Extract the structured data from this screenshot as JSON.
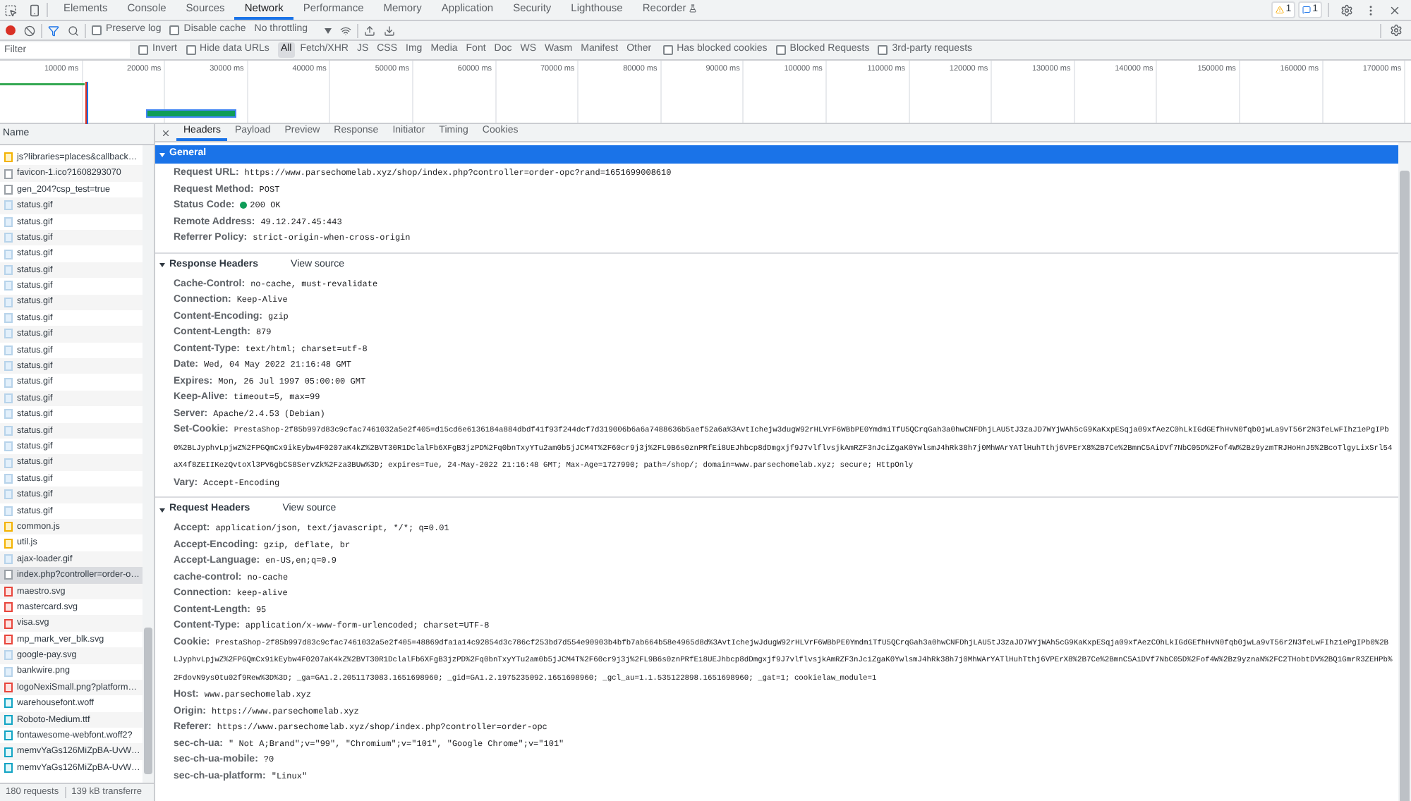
{
  "devtools_tabs": [
    {
      "label": "Elements",
      "selected": false
    },
    {
      "label": "Console",
      "selected": false
    },
    {
      "label": "Sources",
      "selected": false
    },
    {
      "label": "Network",
      "selected": true
    },
    {
      "label": "Performance",
      "selected": false
    },
    {
      "label": "Memory",
      "selected": false
    },
    {
      "label": "Application",
      "selected": false
    },
    {
      "label": "Security",
      "selected": false
    },
    {
      "label": "Lighthouse",
      "selected": false
    },
    {
      "label": "Recorder",
      "selected": false
    }
  ],
  "badges": {
    "warnings": "1",
    "messages": "1"
  },
  "toolbar": {
    "recording": true,
    "checkboxes": [
      {
        "label": "Preserve log",
        "checked": false
      },
      {
        "label": "Disable cache",
        "checked": false
      }
    ],
    "throttling": "No throttling"
  },
  "filter": {
    "placeholder": "Filter",
    "checkboxes_left": [
      {
        "label": "Invert",
        "checked": false
      },
      {
        "label": "Hide data URLs",
        "checked": false
      }
    ],
    "types": [
      {
        "label": "All",
        "selected": true
      },
      {
        "label": "Fetch/XHR",
        "selected": false
      },
      {
        "label": "JS",
        "selected": false
      },
      {
        "label": "CSS",
        "selected": false
      },
      {
        "label": "Img",
        "selected": false
      },
      {
        "label": "Media",
        "selected": false
      },
      {
        "label": "Font",
        "selected": false
      },
      {
        "label": "Doc",
        "selected": false
      },
      {
        "label": "WS",
        "selected": false
      },
      {
        "label": "Wasm",
        "selected": false
      },
      {
        "label": "Manifest",
        "selected": false
      },
      {
        "label": "Other",
        "selected": false
      }
    ],
    "checkboxes_right": [
      {
        "label": "Has blocked cookies",
        "checked": false
      },
      {
        "label": "Blocked Requests",
        "checked": false
      },
      {
        "label": "3rd-party requests",
        "checked": false
      }
    ]
  },
  "overview": {
    "ticks": [
      "10000 ms",
      "20000 ms",
      "30000 ms",
      "40000 ms",
      "50000 ms",
      "60000 ms",
      "70000 ms",
      "80000 ms",
      "90000 ms",
      "100000 ms",
      "110000 ms",
      "120000 ms",
      "130000 ms",
      "140000 ms",
      "150000 ms",
      "160000 ms",
      "170000 ms"
    ]
  },
  "requests": {
    "column": "Name",
    "items": [
      {
        "name": "js?libraries=places&callback…",
        "kind": "script",
        "selected": false
      },
      {
        "name": "favicon-1.ico?1608293070",
        "kind": "document",
        "selected": false
      },
      {
        "name": "gen_204?csp_test=true",
        "kind": "document",
        "selected": false
      },
      {
        "name": "status.gif",
        "kind": "image",
        "selected": false
      },
      {
        "name": "status.gif",
        "kind": "image",
        "selected": false
      },
      {
        "name": "status.gif",
        "kind": "image",
        "selected": false
      },
      {
        "name": "status.gif",
        "kind": "image",
        "selected": false
      },
      {
        "name": "status.gif",
        "kind": "image",
        "selected": false
      },
      {
        "name": "status.gif",
        "kind": "image",
        "selected": false
      },
      {
        "name": "status.gif",
        "kind": "image",
        "selected": false
      },
      {
        "name": "status.gif",
        "kind": "image",
        "selected": false
      },
      {
        "name": "status.gif",
        "kind": "image",
        "selected": false
      },
      {
        "name": "status.gif",
        "kind": "image",
        "selected": false
      },
      {
        "name": "status.gif",
        "kind": "image",
        "selected": false
      },
      {
        "name": "status.gif",
        "kind": "image",
        "selected": false
      },
      {
        "name": "status.gif",
        "kind": "image",
        "selected": false
      },
      {
        "name": "status.gif",
        "kind": "image",
        "selected": false
      },
      {
        "name": "status.gif",
        "kind": "image",
        "selected": false
      },
      {
        "name": "status.gif",
        "kind": "image",
        "selected": false
      },
      {
        "name": "status.gif",
        "kind": "image",
        "selected": false
      },
      {
        "name": "status.gif",
        "kind": "image",
        "selected": false
      },
      {
        "name": "status.gif",
        "kind": "image",
        "selected": false
      },
      {
        "name": "status.gif",
        "kind": "image",
        "selected": false
      },
      {
        "name": "common.js",
        "kind": "script",
        "selected": false
      },
      {
        "name": "util.js",
        "kind": "script",
        "selected": false
      },
      {
        "name": "ajax-loader.gif",
        "kind": "image",
        "selected": false
      },
      {
        "name": "index.php?controller=order-o…",
        "kind": "document",
        "selected": true
      },
      {
        "name": "maestro.svg",
        "kind": "card",
        "selected": false
      },
      {
        "name": "mastercard.svg",
        "kind": "card",
        "selected": false
      },
      {
        "name": "visa.svg",
        "kind": "card",
        "selected": false
      },
      {
        "name": "mp_mark_ver_blk.svg",
        "kind": "card",
        "selected": false
      },
      {
        "name": "google-pay.svg",
        "kind": "image",
        "selected": false
      },
      {
        "name": "bankwire.png",
        "kind": "image",
        "selected": false
      },
      {
        "name": "logoNexiSmall.png?platform…",
        "kind": "card",
        "selected": false
      },
      {
        "name": "warehousefont.woff",
        "kind": "font",
        "selected": false
      },
      {
        "name": "Roboto-Medium.ttf",
        "kind": "font",
        "selected": false
      },
      {
        "name": "fontawesome-webfont.woff2?",
        "kind": "font",
        "selected": false
      },
      {
        "name": "memvYaGs126MiZpBA-UvW…",
        "kind": "font",
        "selected": false
      },
      {
        "name": "memvYaGs126MiZpBA-UvW…",
        "kind": "font",
        "selected": false
      }
    ],
    "summary": [
      "180 requests",
      "139 kB transferre"
    ]
  },
  "detail": {
    "tabs": [
      {
        "label": "Headers",
        "selected": true
      },
      {
        "label": "Payload",
        "selected": false
      },
      {
        "label": "Preview",
        "selected": false
      },
      {
        "label": "Response",
        "selected": false
      },
      {
        "label": "Initiator",
        "selected": false
      },
      {
        "label": "Timing",
        "selected": false
      },
      {
        "label": "Cookies",
        "selected": false
      }
    ],
    "sections": [
      {
        "title": "General",
        "focused": true,
        "expanded": true,
        "rows": [
          {
            "name": "Request URL:",
            "value": "https://www.parsechomelab.xyz/shop/index.php?controller=order-opc?rand=1651699008610",
            "kind": "text"
          },
          {
            "name": "Request Method:",
            "value": "POST",
            "kind": "text"
          },
          {
            "name": "Status Code:",
            "value": "200 OK",
            "kind": "status"
          },
          {
            "name": "Remote Address:",
            "value": "49.12.247.45:443",
            "kind": "text"
          },
          {
            "name": "Referrer Policy:",
            "value": "strict-origin-when-cross-origin",
            "kind": "text"
          }
        ]
      },
      {
        "title": "Response Headers",
        "link": "View source",
        "focused": false,
        "expanded": true,
        "rows": [
          {
            "name": "Cache-Control:",
            "value": "no-cache, must-revalidate",
            "kind": "text"
          },
          {
            "name": "Connection:",
            "value": "Keep-Alive",
            "kind": "text"
          },
          {
            "name": "Content-Encoding:",
            "value": "gzip",
            "kind": "text"
          },
          {
            "name": "Content-Length:",
            "value": "879",
            "kind": "text"
          },
          {
            "name": "Content-Type:",
            "value": "text/html; charset=utf-8",
            "kind": "text"
          },
          {
            "name": "Date:",
            "value": "Wed, 04 May 2022 21:16:48 GMT",
            "kind": "text"
          },
          {
            "name": "Expires:",
            "value": "Mon, 26 Jul 1997 05:00:00 GMT",
            "kind": "text"
          },
          {
            "name": "Keep-Alive:",
            "value": "timeout=5, max=99",
            "kind": "text"
          },
          {
            "name": "Server:",
            "value": "Apache/2.4.53 (Debian)",
            "kind": "text"
          },
          {
            "name": "Set-Cookie:",
            "value": "PrestaShop-2f85b997d83c9cfac7461032a5e2f405=d15cd6e6136184a884dbdf41f93f244dcf7d319006b6a6a7488636b5aef52a6a%3AvtIchejw3dugW92rHLVrF6WBbPE0YmdmiTfU5QCrqGah3a0hwCNFDhjLAU5tJ3zaJD7WYjWAh5cG9KaKxpESqja09xfAezC0hLkIGdGEfhHvN0fqb0jwLa9vT56r2N3feLwFIhz1ePgIPb0%2BLJyphvLpjwZ%2FPGQmCx9ikEybw4F0207aK4kZ%2BVT30R1DclalFb6XFgB3jzPD%2Fq0bnTxyYTu2am0b5jJCM4T%2F60cr9j3j%2FL9B6s0znPRfEi8UEJhbcp8dDmgxjf9J7vlflvsjkAmRZF3nJciZgaK0YwlsmJ4hRk38h7j0MhWArYATlHuhTthj6VPErX8%2B7Ce%2BmnC5AiDVf7NbC05D%2Fof4W%2Bz9yzmTRJHoHnJ5%2BcoTlgyLixSrl54aX4f8ZEIIKezQvtoXl3PV6gbCS8ServZk%2Fza3BUw%3D; expires=Tue, 24-May-2022 21:16:48 GMT; Max-Age=1727990; path=/shop/; domain=www.parsechomelab.xyz; secure; HttpOnly",
            "kind": "long"
          },
          {
            "name": "Vary:",
            "value": "Accept-Encoding",
            "kind": "text"
          }
        ]
      },
      {
        "title": "Request Headers",
        "link": "View source",
        "focused": false,
        "expanded": true,
        "rows": [
          {
            "name": "Accept:",
            "value": "application/json, text/javascript, */*; q=0.01",
            "kind": "text"
          },
          {
            "name": "Accept-Encoding:",
            "value": "gzip, deflate, br",
            "kind": "text"
          },
          {
            "name": "Accept-Language:",
            "value": "en-US,en;q=0.9",
            "kind": "text"
          },
          {
            "name": "cache-control:",
            "value": "no-cache",
            "kind": "text"
          },
          {
            "name": "Connection:",
            "value": "keep-alive",
            "kind": "text"
          },
          {
            "name": "Content-Length:",
            "value": "95",
            "kind": "text"
          },
          {
            "name": "Content-Type:",
            "value": "application/x-www-form-urlencoded; charset=UTF-8",
            "kind": "text"
          },
          {
            "name": "Cookie:",
            "value": "PrestaShop-2f85b997d83c9cfac7461032a5e2f405=48869dfa1a14c92854d3c786cf253bd7d554e90903b4bfb7ab664b58e4965d8d%3AvtIchejwJdugW92rHLVrF6WBbPE0YmdmiTfU5QCrqGah3a0hwCNFDhjLAU5tJ3zaJD7WYjWAh5cG9KaKxpESqja09xfAezC0hLkIGdGEfhHvN0fqb0jwLa9vT56r2N3feLwFIhz1ePgIPb0%2BLJyphvLpjwZ%2FPGQmCx9ikEybw4F0207aK4kZ%2BVT30R1DclalFb6XFgB3jzPD%2Fq0bnTxyYTu2am0b5jJCM4T%2F60cr9j3j%2FL9B6s0znPRfEi8UEJhbcp8dDmgxjf9J7vlflvsjkAmRZF3nJciZgaK0YwlsmJ4hRk38h7j0MhWArYATlHuhTthj6VPErX8%2B7Ce%2BmnC5AiDVf7NbC05D%2Fof4W%2Bz9yznaN%2FC2THobtDV%2BQ1GmrR3ZEHPb%2FdovN9ys0tu02f9Rew%3D%3D; _ga=GA1.2.2051173083.1651698960; _gid=GA1.2.1975235092.1651698960; _gcl_au=1.1.535122898.1651698960; _gat=1; cookielaw_module=1",
            "kind": "long"
          },
          {
            "name": "Host:",
            "value": "www.parsechomelab.xyz",
            "kind": "text"
          },
          {
            "name": "Origin:",
            "value": "https://www.parsechomelab.xyz",
            "kind": "text"
          },
          {
            "name": "Referer:",
            "value": "https://www.parsechomelab.xyz/shop/index.php?controller=order-opc",
            "kind": "text"
          },
          {
            "name": "sec-ch-ua:",
            "value": "\" Not A;Brand\";v=\"99\", \"Chromium\";v=\"101\", \"Google Chrome\";v=\"101\"",
            "kind": "text"
          },
          {
            "name": "sec-ch-ua-mobile:",
            "value": "?0",
            "kind": "text"
          },
          {
            "name": "sec-ch-ua-platform:",
            "value": "\"Linux\"",
            "kind": "text"
          }
        ]
      }
    ]
  }
}
